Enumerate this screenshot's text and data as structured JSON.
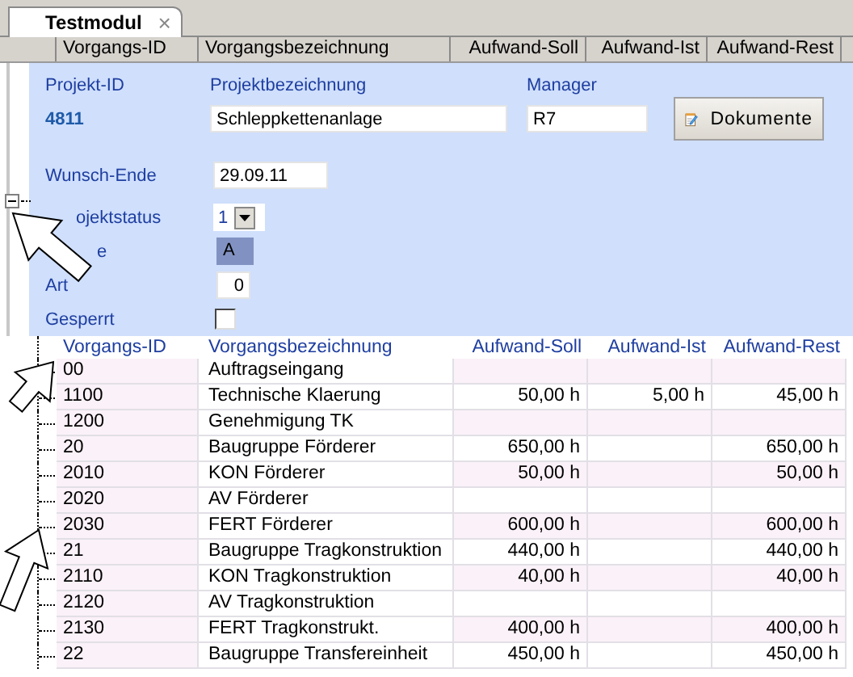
{
  "tab": {
    "label": "Testmodul",
    "close": "×",
    "selected": true
  },
  "columns": [
    "Vorgangs-ID",
    "Vorgangsbezeichnung",
    "Aufwand-Soll",
    "Aufwand-Ist",
    "Aufwand-Rest"
  ],
  "project": {
    "id_label": "Projekt-ID",
    "id": "4811",
    "name_label": "Projektbezeichnung",
    "name": "Schleppkettenanlage",
    "manager_label": "Manager",
    "manager": "R7",
    "documents_button": "Dokumente",
    "fields": [
      {
        "kind": "text",
        "label": "Wunsch-Ende",
        "value": "29.09.11"
      },
      {
        "kind": "select",
        "label": "ojektstatus",
        "value": "1"
      },
      {
        "kind": "badge",
        "label": "e",
        "value": "A"
      },
      {
        "kind": "number",
        "label": "Art",
        "value": "0"
      },
      {
        "kind": "checkbox",
        "label": "Gesperrt",
        "checked": false
      }
    ]
  },
  "tree": {
    "expanded": true
  },
  "grid": {
    "columns": [
      "Vorgangs-ID",
      "Vorgangsbezeichnung",
      "Aufwand-Soll",
      "Aufwand-Ist",
      "Aufwand-Rest"
    ],
    "rows": [
      {
        "id": "00",
        "name": "Auftragseingang"
      },
      {
        "id": "1100",
        "name": "Technische Klaerung",
        "soll": "50,00 h",
        "ist": "5,00 h",
        "rest": "45,00 h"
      },
      {
        "id": "1200",
        "name": "Genehmigung TK"
      },
      {
        "id": "20",
        "name": "Baugruppe Förderer",
        "soll": "650,00 h",
        "rest": "650,00 h"
      },
      {
        "id": "2010",
        "name": "KON Förderer",
        "soll": "50,00 h",
        "rest": "50,00 h"
      },
      {
        "id": "2020",
        "name": "AV Förderer"
      },
      {
        "id": "2030",
        "name": "FERT Förderer",
        "soll": "600,00 h",
        "rest": "600,00 h"
      },
      {
        "id": "21",
        "name": "Baugruppe Tragkonstruktion",
        "soll": "440,00 h",
        "rest": "440,00 h"
      },
      {
        "id": "2110",
        "name": "KON Tragkonstruktion",
        "soll": "40,00 h",
        "rest": "40,00 h"
      },
      {
        "id": "2120",
        "name": "AV Tragkonstruktion"
      },
      {
        "id": "2130",
        "name": "FERT Tragkonstrukt.",
        "soll": "400,00 h",
        "rest": "400,00 h"
      },
      {
        "id": "22",
        "name": "Baugruppe Transfereinheit",
        "soll": "450,00 h",
        "rest": "450,00 h"
      }
    ]
  }
}
